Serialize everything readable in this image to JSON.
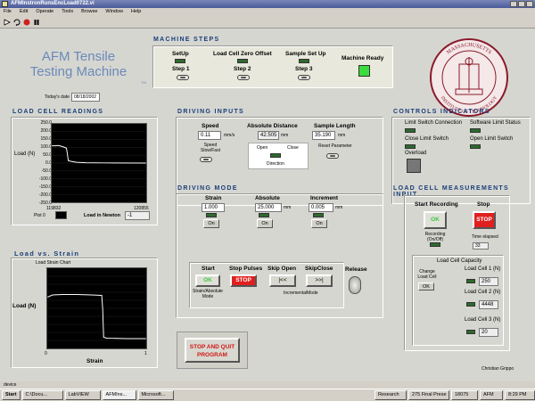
{
  "window": {
    "title": "AFMInstronRunsEncLoad0722.vi",
    "menu": [
      "File",
      "Edit",
      "Operate",
      "Tools",
      "Browse",
      "Window",
      "Help"
    ]
  },
  "app": {
    "title_line1": "AFM Tensile",
    "title_line2": "Testing Machine",
    "tm": "TM",
    "date_label": "Today's date",
    "date_value": "08/18/2002"
  },
  "machine_steps": {
    "header": "MACHINE STEPS",
    "setup": "SetUp",
    "step1": "Step 1",
    "zero_offset": "Load Cell Zero Offset",
    "step2": "Step 2",
    "sample_setup": "Sample Set Up",
    "step3": "Step 3",
    "machine_ready": "Machine Ready"
  },
  "seal": {
    "top_text": "MASSACHUSETTS",
    "bottom_text": "INSTITUTE OF TECHNOLOGY",
    "color": "#8a1a2a"
  },
  "load_cell_readings": {
    "header": "LOAD CELL READINGS",
    "ylabel": "Load (N)",
    "yticks": [
      "250.0",
      "200.0",
      "150.0",
      "100.0",
      "50.0",
      "0.0",
      "-50.0",
      "-100.0",
      "-150.0",
      "-200.0",
      "-250.0"
    ],
    "xmin": "119832",
    "xmax": "120855",
    "plot_label": "Plot 0",
    "load_newton_label": "Load in Newton",
    "load_newton_value": "-1"
  },
  "driving_inputs": {
    "header": "DRIVING INPUTS",
    "speed_label": "Speed",
    "speed_value": "0.11",
    "speed_unit": "mm/s",
    "speed_toggle_label": "Speed Slow/Fast",
    "abs_distance_label": "Absolute Distance",
    "abs_distance_value": "42.505",
    "abs_distance_unit": "mm",
    "direction_open": "Open",
    "direction_close": "Close",
    "direction_label": "Direction",
    "sample_length_label": "Sample Length",
    "sample_length_value": "35.190",
    "sample_length_unit": "mm",
    "reset_label": "Reset Parameter"
  },
  "controls_indicators": {
    "header": "CONTROLS INDICATORS",
    "limit_conn": "Limit Switch Connection",
    "software_limit": "Software Limit Status",
    "close_limit": "Close Limit Switch",
    "open_limit": "Open Limit Switch",
    "overload": "Overload"
  },
  "driving_mode": {
    "header": "DRIVING MODE",
    "strain_label": "Strain",
    "strain_value": "1.000",
    "absolute_label": "Absolute",
    "absolute_value": "25.000",
    "absolute_unit": "mm",
    "increment_label": "Increment",
    "increment_value": "0.005",
    "increment_unit": "mm",
    "on_label": "On",
    "start_label": "Start",
    "ok_label": "OK",
    "strain_abs_mode": "Strain/Absolute Mode",
    "stop_pulses_label": "Stop Pulses",
    "stop_label": "STOP",
    "skip_open_label": "Skip Open",
    "skip_open_btn": "|<<",
    "skip_close_label": "SkipClose",
    "skip_close_btn": ">>|",
    "incremental_mode": "IncrementalMode",
    "release_label": "Release"
  },
  "load_strain": {
    "header": "Load vs. Strain",
    "chart_title": "Load Strain Chart",
    "ylabel": "Load (N)",
    "xlabel": "Strain",
    "xmin": "0",
    "xmax": "1"
  },
  "stop_quit": {
    "line1": "STOP AND QUIT",
    "line2": "PROGRAM"
  },
  "load_cell_measurements": {
    "header": "LOAD CELL MEASUREMENTS INPUT",
    "start_recording": "Start Recording",
    "stop_label": "Stop",
    "ok_label": "OK",
    "stop_btn": "STOP",
    "recording_label": "Recording (On/Off)",
    "time_elapsed_label": "Time elapsed",
    "time_elapsed_value": "33",
    "capacity_label": "Load Cell Capacity",
    "change_label": "Change Load Cell",
    "change_ok": "OK",
    "cell1_label": "Load Cell 1  (N)",
    "cell1_value": "250",
    "cell2_label": "Load Cell 2  (N)",
    "cell2_value": "4448",
    "cell3_label": "Load Cell 3  (N)",
    "cell3_value": "20"
  },
  "author": "Christian Grippo",
  "status": "device",
  "taskbar": {
    "start": "Start",
    "items": [
      "C:\\Docu...",
      "LabVIEW",
      "AFMIns...",
      "Microsoft..."
    ],
    "tray": [
      "Research",
      "275 Final Prese",
      "18075",
      "AFM"
    ],
    "clock": "8:29 PM"
  },
  "colors": {
    "header": "#1a3f78",
    "led_on": "#3cdc3c",
    "led_off": "#2d6a2d",
    "ok_green": "#3cc83c",
    "stop_red": "#e02020"
  },
  "chart_data": [
    {
      "type": "line",
      "title": "",
      "xlabel": "",
      "ylabel": "Load (N)",
      "ylim": [
        -250,
        250
      ],
      "xlim": [
        119832,
        120855
      ],
      "series": [
        {
          "x": [
            119832,
            119870,
            119900,
            119930,
            119960,
            119990,
            120000,
            120010,
            120050,
            120100,
            120200,
            120400,
            120855
          ],
          "y": [
            110,
            110,
            112,
            108,
            102,
            95,
            60,
            15,
            10,
            5,
            2,
            1,
            0
          ]
        }
      ]
    },
    {
      "type": "line",
      "title": "Load Strain Chart",
      "xlabel": "Strain",
      "ylabel": "Load (N)",
      "xlim": [
        0,
        1
      ],
      "series": [
        {
          "x": [
            0,
            0.05,
            0.15,
            0.3,
            0.45,
            0.55,
            0.56,
            0.57,
            0.6,
            0.8,
            1.0
          ],
          "y": [
            95,
            100,
            101,
            101,
            100,
            99,
            70,
            5,
            3,
            2,
            2
          ]
        }
      ]
    }
  ]
}
